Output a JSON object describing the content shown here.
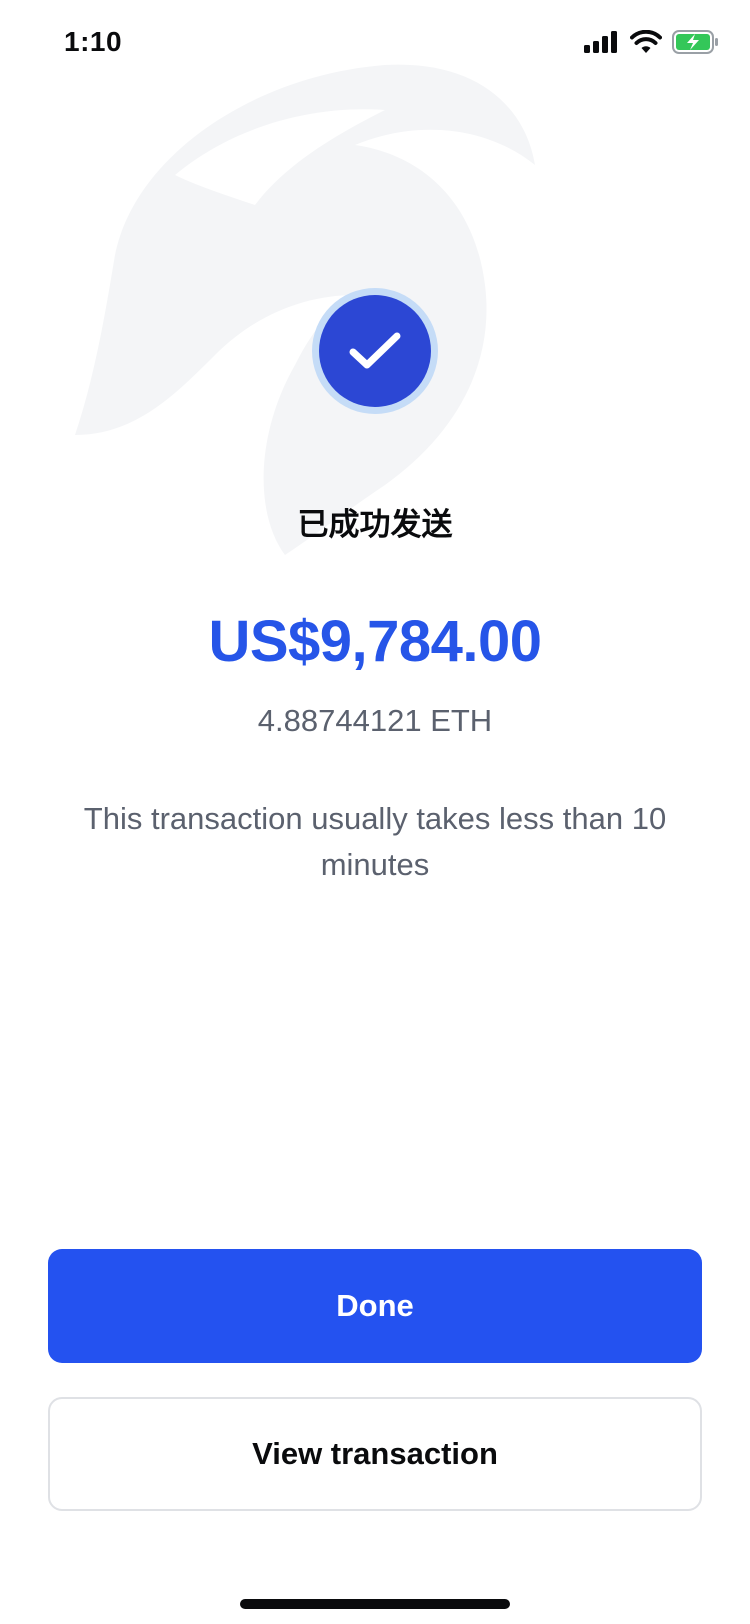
{
  "status_bar": {
    "time": "1:10",
    "icons": [
      "cellular-signal-icon",
      "wifi-icon",
      "battery-charging-icon"
    ]
  },
  "confirmation": {
    "icon": "checkmark-icon",
    "title": "已成功发送",
    "fiat_amount": "US$9,784.00",
    "crypto_amount": "4.88744121 ETH",
    "eta_message": "This transaction usually takes less than 10 minutes"
  },
  "actions": {
    "done_label": "Done",
    "view_transaction_label": "View transaction"
  },
  "colors": {
    "accent": "#2452f0",
    "amount": "#2655e8",
    "check_bg": "#2c47d4",
    "secondary_text": "#5b616e"
  }
}
